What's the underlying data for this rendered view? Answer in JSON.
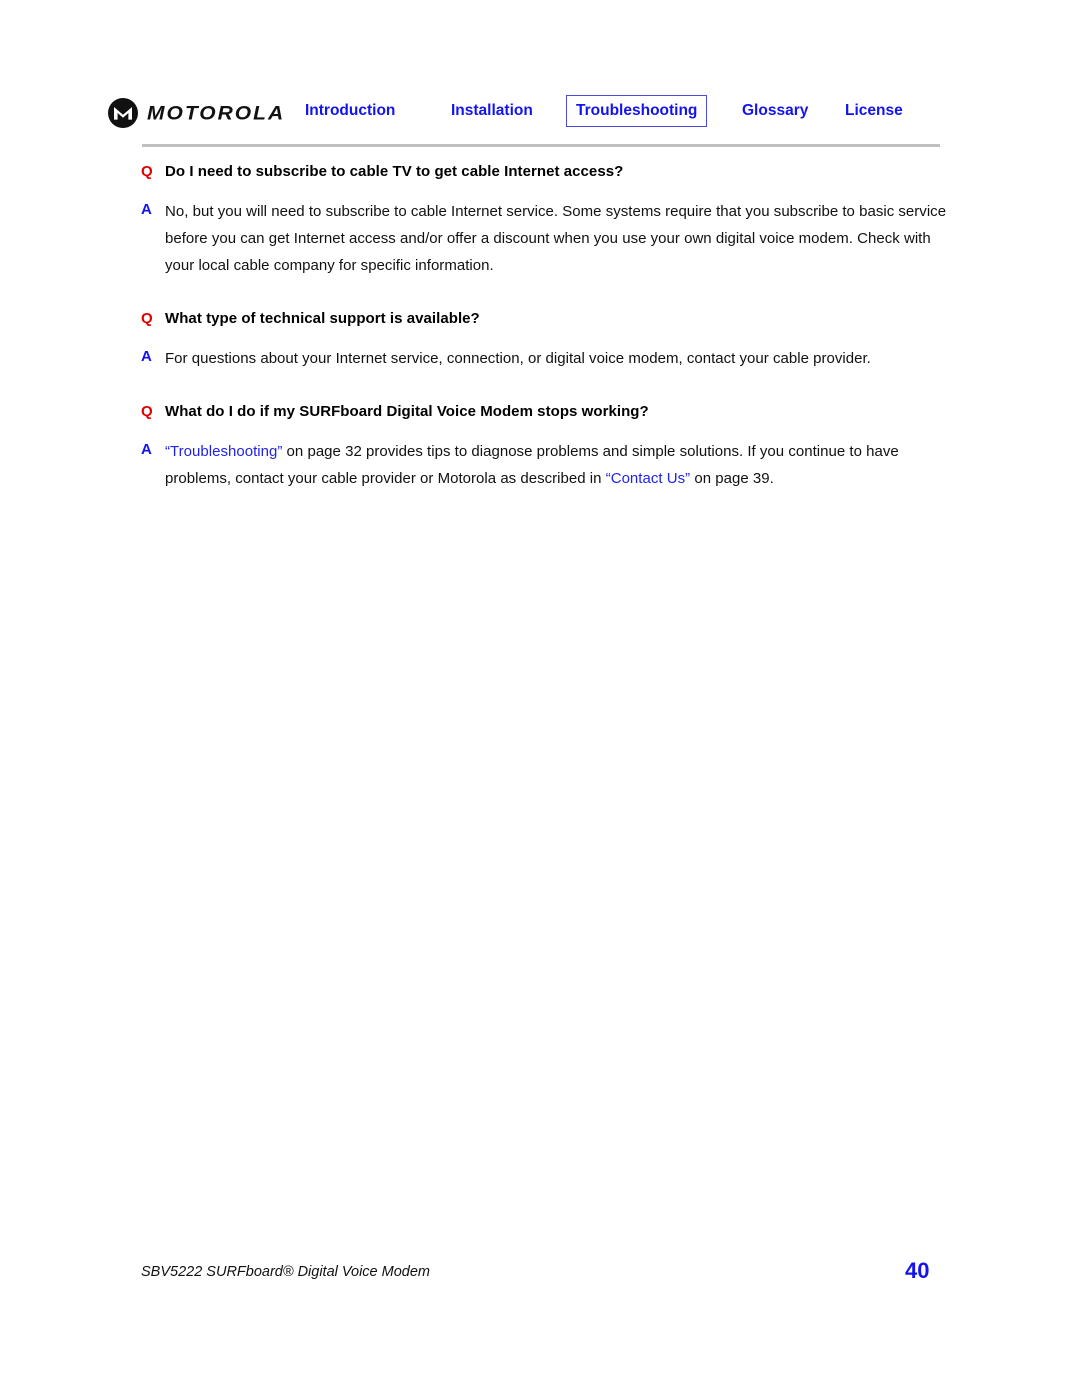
{
  "document": {
    "brand": "MOTOROLA",
    "logo_icon": "motorola-batwing-icon"
  },
  "nav": {
    "items": [
      {
        "label": "Introduction",
        "active": false
      },
      {
        "label": "Installation",
        "active": false
      },
      {
        "label": "Troubleshooting",
        "active": true
      },
      {
        "label": "Glossary",
        "active": false
      },
      {
        "label": "License",
        "active": false
      }
    ],
    "link_color": "#1313f0",
    "active_border_color": "#4b4be0"
  },
  "faq": {
    "q_marker": "Q",
    "a_marker": "A",
    "q_color": "#e00000",
    "a_color": "#1313f0",
    "entries": [
      {
        "question": "Do I need to subscribe to cable TV to get cable Internet access?",
        "answer": "No, but you will need to subscribe to cable Internet service. Some systems require that you subscribe to basic service before you can get Internet access and/or offer a discount when you use your own digital voice modem. Check with your local cable company for specific information."
      },
      {
        "question": "What type of technical support is available?",
        "answer": "For questions about your Internet service, connection, or digital voice modem, contact your cable provider."
      },
      {
        "question": "What do I do if my SURFboard Digital Voice Modem stops working?",
        "answer_parts": {
          "link1": "“Troubleshooting”",
          "text1": " on page 32 provides tips to diagnose problems and simple solutions. If you continue to have problems, contact your cable provider or Motorola as described in ",
          "link2": "“Contact Us”",
          "text2": " on page 39."
        }
      }
    ]
  },
  "footer": {
    "title": "SBV5222 SURFboard® Digital Voice Modem",
    "page_number": "40",
    "page_number_color": "#1313f0"
  }
}
